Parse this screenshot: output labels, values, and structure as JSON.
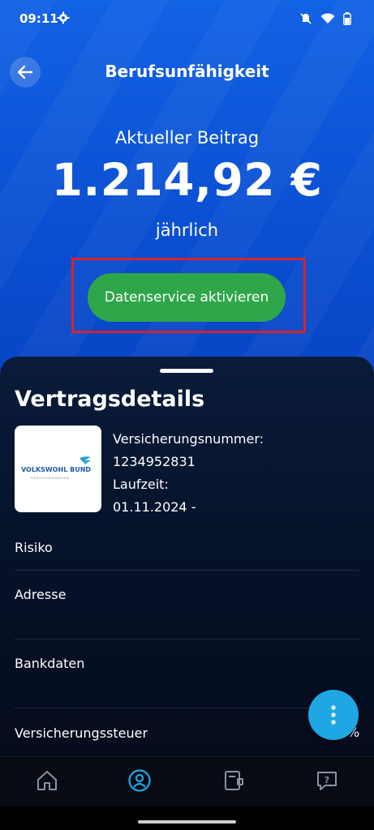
{
  "status_bar": {
    "time": "09:11"
  },
  "header": {
    "title": "Berufsunfähigkeit"
  },
  "premium": {
    "label": "Aktueller Beitrag",
    "amount": "1.214,92 €",
    "period": "jährlich"
  },
  "cta": {
    "label": "Datenservice aktivieren"
  },
  "details": {
    "title": "Vertragsdetails",
    "logo_text": "VOLKSWOHL BUND",
    "logo_subtext": "VERSICHERUNGEN",
    "policy_number_label": "Versicherungsnummer:",
    "policy_number": "1234952831",
    "term_label": "Laufzeit:",
    "term_value": "01.11.2024 -",
    "rows": [
      "Risiko",
      "Adresse",
      "Bankdaten",
      "Versicherungssteuer"
    ],
    "partial_value": "%"
  },
  "colors": {
    "primary_blue": "#0a4fd2",
    "cta_green": "#2fa64a",
    "highlight_red": "#d8232a",
    "fab_blue": "#1fa7e4",
    "nav_active": "#1fa7e4"
  },
  "icons": {
    "status": [
      "gear-icon",
      "mute-icon",
      "wifi-icon",
      "battery-icon"
    ],
    "nav": [
      "home-icon",
      "profile-icon",
      "contracts-icon",
      "help-icon"
    ],
    "fab": "more-vertical-icon",
    "back": "arrow-left-icon"
  }
}
